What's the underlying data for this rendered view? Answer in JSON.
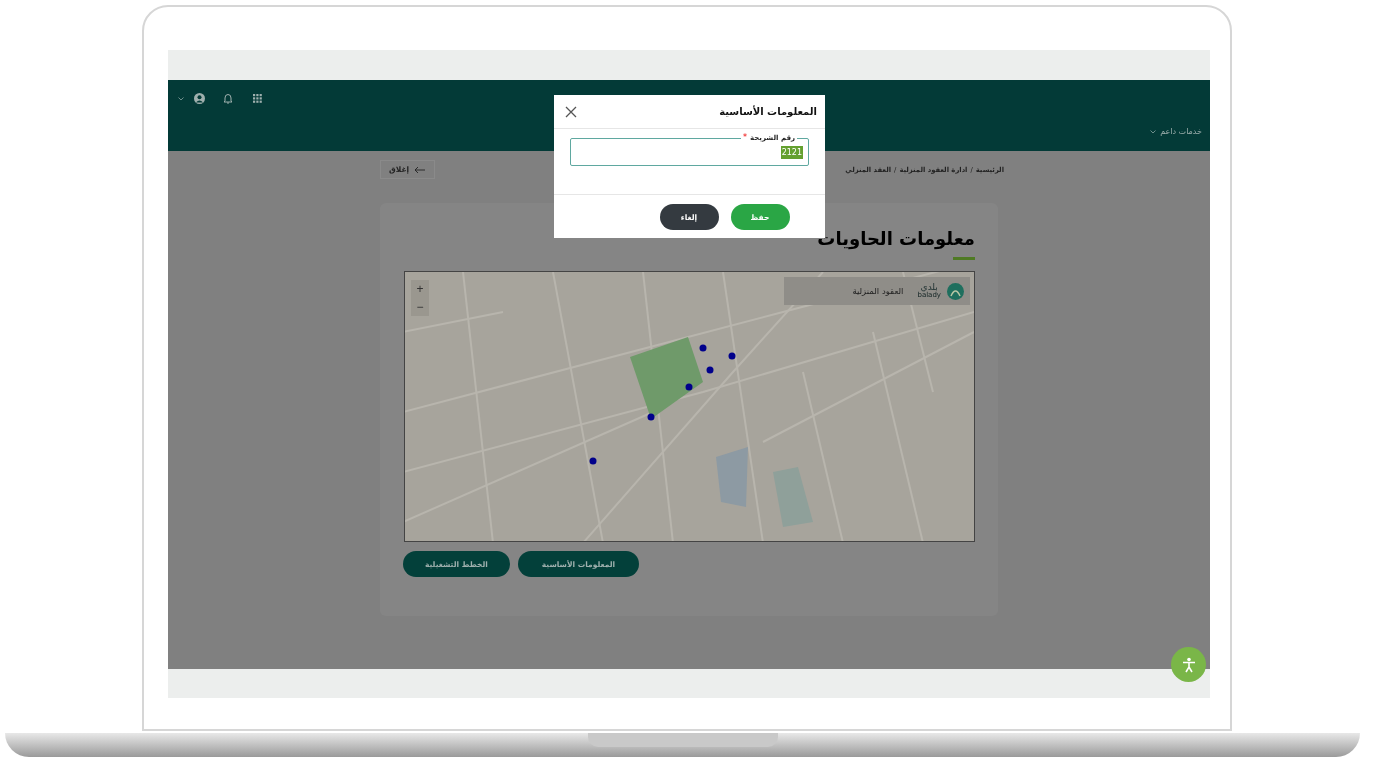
{
  "top_bar": {
    "menu": "خدمات داعم"
  },
  "breadcrumb": {
    "items": [
      "الرئيسية",
      "ادارة العقود المنزلية",
      "العقد المنزلي"
    ],
    "separator": "/"
  },
  "close_button": "إغلاق",
  "card": {
    "title": "معلومات الحاويات",
    "map_label": "العقود المنزلية",
    "logo_text": "بلدي",
    "logo_subtext": "balady",
    "zoom_in": "+",
    "zoom_out": "−",
    "buttons": [
      "المعلومات الأساسية",
      "الخطط التشغيلية"
    ]
  },
  "modal": {
    "title": "المعلومات الأساسية",
    "field": {
      "label": "رقم الشريحة",
      "required_mark": "*",
      "value": "2121"
    },
    "buttons": [
      {
        "label": "حفظ",
        "kind": "primary"
      },
      {
        "label": "إلغاء",
        "kind": "secondary"
      }
    ]
  }
}
